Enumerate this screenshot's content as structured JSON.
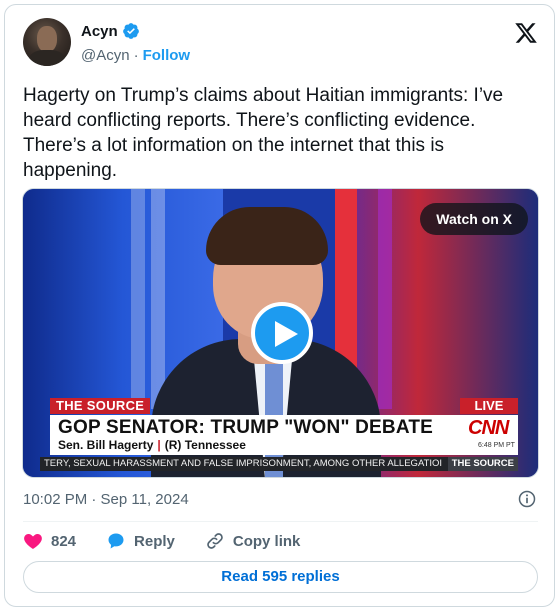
{
  "author": {
    "name": "Acyn",
    "handle": "@Acyn",
    "separator": "·",
    "follow_label": "Follow"
  },
  "tweet": {
    "text": "Hagerty on Trump’s claims about Haitian immigrants: I’ve heard conflicting reports. There’s conflicting evidence. There’s a lot information on the internet that this is happening.",
    "timestamp": "10:02 PM · Sep 11, 2024"
  },
  "video": {
    "watch_label": "Watch on X",
    "lower_third": {
      "show": "THE SOURCE",
      "live": "LIVE",
      "headline": "GOP SENATOR: TRUMP \"WON\" DEBATE",
      "guest_name": "Sen. Bill Hagerty",
      "guest_bar": "|",
      "guest_party": "(R) Tennessee",
      "network": "CNN",
      "time": "6:48 PM PT",
      "ticker": "TERY, SEXUAL HARASSMENT AND FALSE IMPRISONMENT, AMONG OTHER ALLEGATIOI",
      "ticker_tag": "THE SOURCE"
    }
  },
  "actions": {
    "likes": "824",
    "reply_label": "Reply",
    "copy_label": "Copy link"
  },
  "read_replies_label": "Read 595 replies",
  "colors": {
    "accent": "#1d9bf0",
    "like": "#f91880",
    "link": "#006fd6",
    "cnn_red": "#c9202a"
  }
}
